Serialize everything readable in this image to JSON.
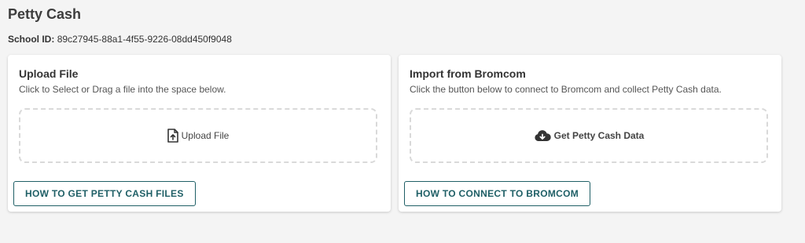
{
  "page": {
    "title": "Petty Cash",
    "school_id_label": "School ID:",
    "school_id_value": "89c27945-88a1-4f55-9226-08dd450f9048"
  },
  "upload_card": {
    "title": "Upload File",
    "description": "Click to Select or Drag a file into the space below.",
    "dropzone_label": "Upload File",
    "dropzone_icon": "file-upload-icon",
    "help_button": "HOW TO GET PETTY CASH FILES"
  },
  "bromcom_card": {
    "title": "Import from Bromcom",
    "description": "Click the button below to connect to Bromcom and collect Petty Cash data.",
    "dropzone_label": "Get Petty Cash Data",
    "dropzone_icon": "cloud-download-icon",
    "help_button": "HOW TO CONNECT TO BROMCOM"
  },
  "colors": {
    "background": "#f4f4f4",
    "accent": "#1f5f66",
    "card": "#ffffff",
    "dropzone_border": "#d9d9d9"
  }
}
